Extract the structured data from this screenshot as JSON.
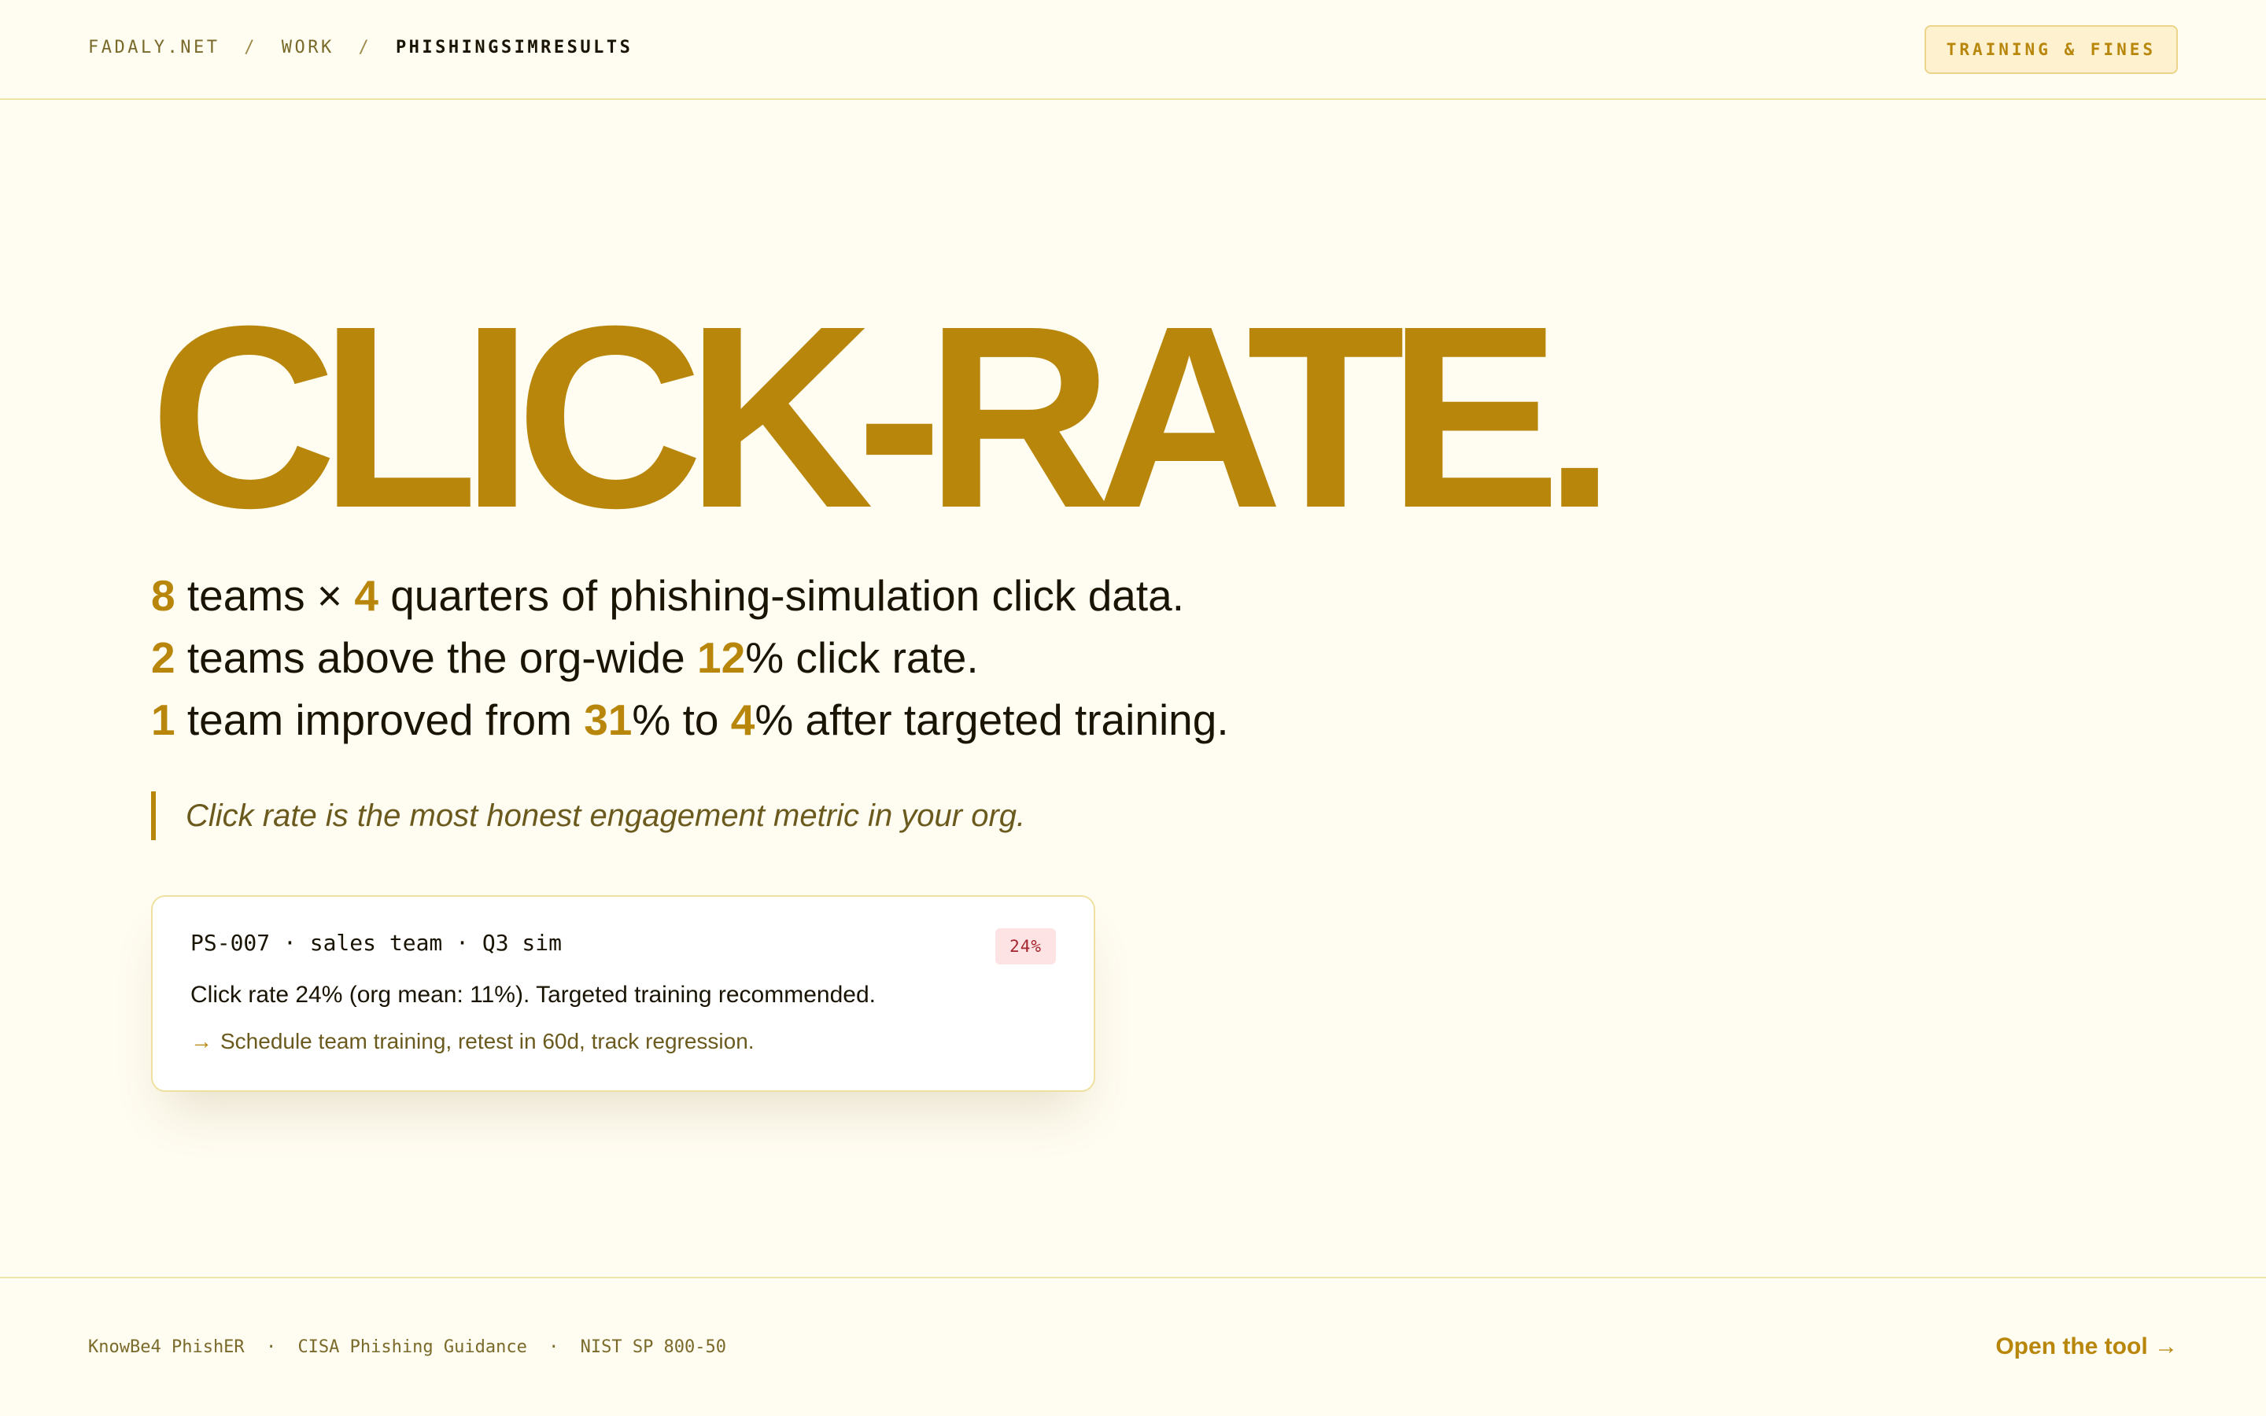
{
  "breadcrumb": {
    "items": [
      "FADALY.NET",
      "WORK",
      "PHISHINGSIMRESULTS"
    ],
    "separator": "/"
  },
  "header": {
    "badge": "TRAINING & FINES"
  },
  "hero": {
    "title": "CLICK-RATE."
  },
  "stats": {
    "line1": {
      "n1": "8",
      "t1": " teams × ",
      "n2": "4",
      "t2": " quarters of phishing-simulation click data."
    },
    "line2": {
      "n1": "2",
      "t1": " teams above the org-wide ",
      "n2": "12",
      "t2": "% click rate."
    },
    "line3": {
      "n1": "1",
      "t1": " team improved from ",
      "n2": "31",
      "t2": "% to ",
      "n3": "4",
      "t3": "% after targeted training."
    }
  },
  "quote": "Click rate is the most honest engagement metric in your org.",
  "card": {
    "header": "PS-007 · sales team · Q3 sim",
    "badge": "24%",
    "body": "Click rate 24% (org mean: 11%). Targeted training recommended.",
    "action_arrow": "→",
    "action": "Schedule team training, retest in 60d, track regression."
  },
  "footer": {
    "sources": [
      "KnowBe4 PhishER",
      "CISA Phishing Guidance",
      "NIST SP 800-50"
    ],
    "source_sep": "·",
    "cta": "Open the tool →"
  },
  "colors": {
    "accent": "#b8860b",
    "background": "#fffcf1",
    "alert": "#a3262f"
  }
}
